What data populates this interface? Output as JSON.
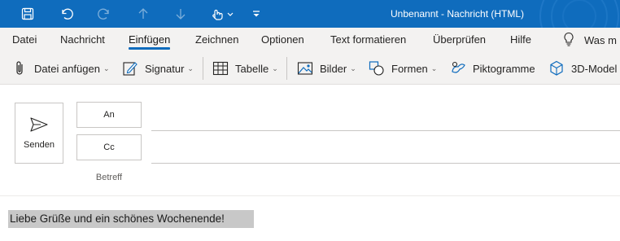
{
  "window": {
    "title": "Unbenannt  -  Nachricht (HTML)"
  },
  "quick_access": {
    "icons": [
      "save-icon",
      "undo-icon",
      "redo-icon",
      "arrow-up-icon",
      "arrow-down-icon",
      "touch-mode-icon",
      "customize-icon"
    ]
  },
  "menu": {
    "tabs": [
      {
        "label": "Datei"
      },
      {
        "label": "Nachricht"
      },
      {
        "label": "Einfügen",
        "active": true
      },
      {
        "label": "Zeichnen"
      },
      {
        "label": "Optionen"
      },
      {
        "label": "Text formatieren"
      },
      {
        "label": "Überprüfen"
      },
      {
        "label": "Hilfe"
      }
    ],
    "tell_me": "Was m"
  },
  "ribbon": {
    "items": [
      {
        "label": "Datei anfügen",
        "icon": "paperclip-icon"
      },
      {
        "label": "Signatur",
        "icon": "signature-icon"
      },
      {
        "label": "Tabelle",
        "icon": "table-icon"
      },
      {
        "label": "Bilder",
        "icon": "picture-icon"
      },
      {
        "label": "Formen",
        "icon": "shapes-icon"
      },
      {
        "label": "Piktogramme",
        "icon": "icons-icon"
      },
      {
        "label": "3D-Model",
        "icon": "cube-icon"
      }
    ]
  },
  "compose": {
    "send_label": "Senden",
    "to_label": "An",
    "cc_label": "Cc",
    "subject_label": "Betreff",
    "body_text": "Liebe Grüße und ein schönes Wochenende!"
  },
  "colors": {
    "titlebar": "#0f6cbd",
    "ribbon_bg": "#f3f2f1",
    "accent": "#0f6cbd",
    "selection": "#c8c8c8"
  }
}
